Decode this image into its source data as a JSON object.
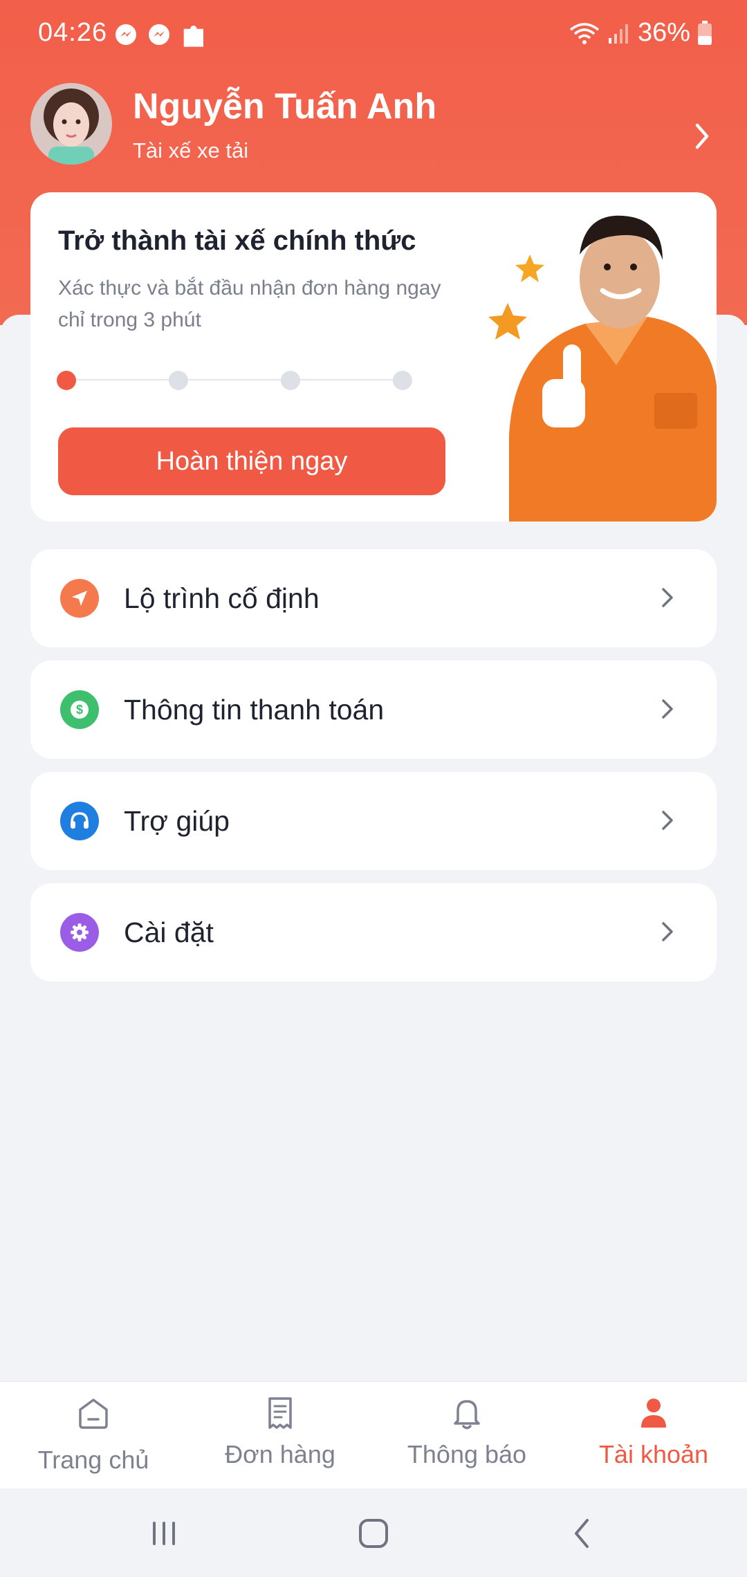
{
  "status_bar": {
    "time": "04:26",
    "battery": "36%",
    "left_icons": [
      "messenger-icon",
      "messenger-icon",
      "puzzle-icon"
    ],
    "right_icons": [
      "wifi-icon",
      "signal-icon",
      "battery-icon"
    ]
  },
  "profile": {
    "name": "Nguyễn Tuấn Anh",
    "role": "Tài xế xe tải"
  },
  "promo": {
    "title": "Trở thành tài xế chính thức",
    "subtitle": "Xác thực và bắt đầu nhận đơn hàng ngay chỉ trong 3 phút",
    "steps_total": 4,
    "steps_current": 1,
    "button_label": "Hoàn thiện ngay"
  },
  "menu": {
    "items": [
      {
        "label": "Lộ trình cố định",
        "icon": "navigation-icon",
        "color": "#f47a4e"
      },
      {
        "label": "Thông tin thanh toán",
        "icon": "dollar-icon",
        "color": "#3dbf6e"
      },
      {
        "label": "Trợ giúp",
        "icon": "headset-icon",
        "color": "#1f7fe0"
      },
      {
        "label": "Cài đặt",
        "icon": "gear-icon",
        "color": "#9b5de5"
      }
    ]
  },
  "bottom_nav": {
    "tabs": [
      {
        "label": "Trang chủ",
        "icon": "home-icon",
        "active": false
      },
      {
        "label": "Đơn hàng",
        "icon": "receipt-icon",
        "active": false
      },
      {
        "label": "Thông báo",
        "icon": "bell-icon",
        "active": false
      },
      {
        "label": "Tài khoản",
        "icon": "user-icon",
        "active": true
      }
    ]
  },
  "colors": {
    "accent": "#f05a45",
    "header": "#f26a52",
    "background": "#f1f3f6"
  }
}
